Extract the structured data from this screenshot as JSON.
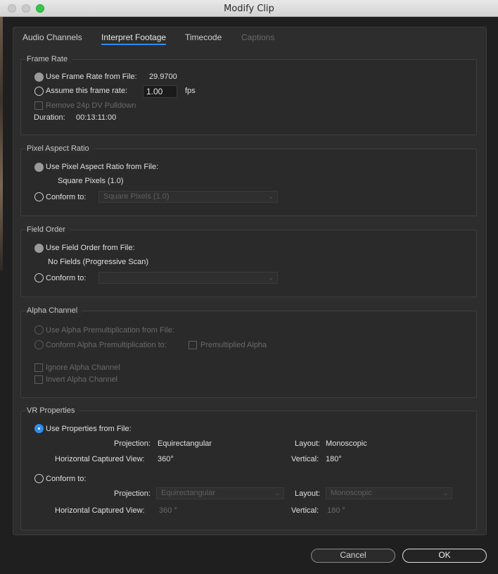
{
  "window": {
    "title": "Modify Clip"
  },
  "tabs": [
    {
      "label": "Audio Channels",
      "state": "normal"
    },
    {
      "label": "Interpret Footage",
      "state": "active"
    },
    {
      "label": "Timecode",
      "state": "normal"
    },
    {
      "label": "Captions",
      "state": "disabled"
    }
  ],
  "frame_rate": {
    "title": "Frame Rate",
    "use_file_label": "Use Frame Rate from File:",
    "file_value": "29.9700",
    "assume_label": "Assume this frame rate:",
    "assume_value": "1.00",
    "fps_unit": "fps",
    "remove_pulldown_label": "Remove 24p DV Pulldown",
    "duration_label": "Duration:",
    "duration_value": "00:13:11:00"
  },
  "pixel_aspect": {
    "title": "Pixel Aspect Ratio",
    "use_file_label": "Use Pixel Aspect Ratio from File:",
    "file_value": "Square Pixels (1.0)",
    "conform_label": "Conform to:",
    "conform_value": "Square Pixels (1.0)"
  },
  "field_order": {
    "title": "Field Order",
    "use_file_label": "Use Field Order from File:",
    "file_value": "No Fields (Progressive Scan)",
    "conform_label": "Conform to:",
    "conform_value": ""
  },
  "alpha": {
    "title": "Alpha Channel",
    "use_premult_label": "Use Alpha Premultiplication from File:",
    "conform_premult_label": "Conform Alpha Premultiplication to:",
    "premultiplied_label": "Premultiplied Alpha",
    "ignore_label": "Ignore Alpha Channel",
    "invert_label": "Invert Alpha Channel"
  },
  "vr": {
    "title": "VR Properties",
    "use_file_label": "Use Properties from File:",
    "projection_label": "Projection:",
    "projection_value": "Equirectangular",
    "layout_label": "Layout:",
    "layout_value": "Monoscopic",
    "hview_label": "Horizontal Captured View:",
    "hview_value": "360°",
    "vertical_label": "Vertical:",
    "vertical_value": "180°",
    "conform_label": "Conform to:",
    "conform_projection_label": "Projection:",
    "conform_projection_value": "Equirectangular",
    "conform_layout_label": "Layout:",
    "conform_layout_value": "Monoscopic",
    "conform_hview_label": "Horizontal Captured View:",
    "conform_hview_value": "360 °",
    "conform_vertical_label": "Vertical:",
    "conform_vertical_value": "180 °"
  },
  "buttons": {
    "cancel": "Cancel",
    "ok": "OK"
  },
  "colors": {
    "accent": "#2d8ceb",
    "background": "#2d2d2d"
  }
}
